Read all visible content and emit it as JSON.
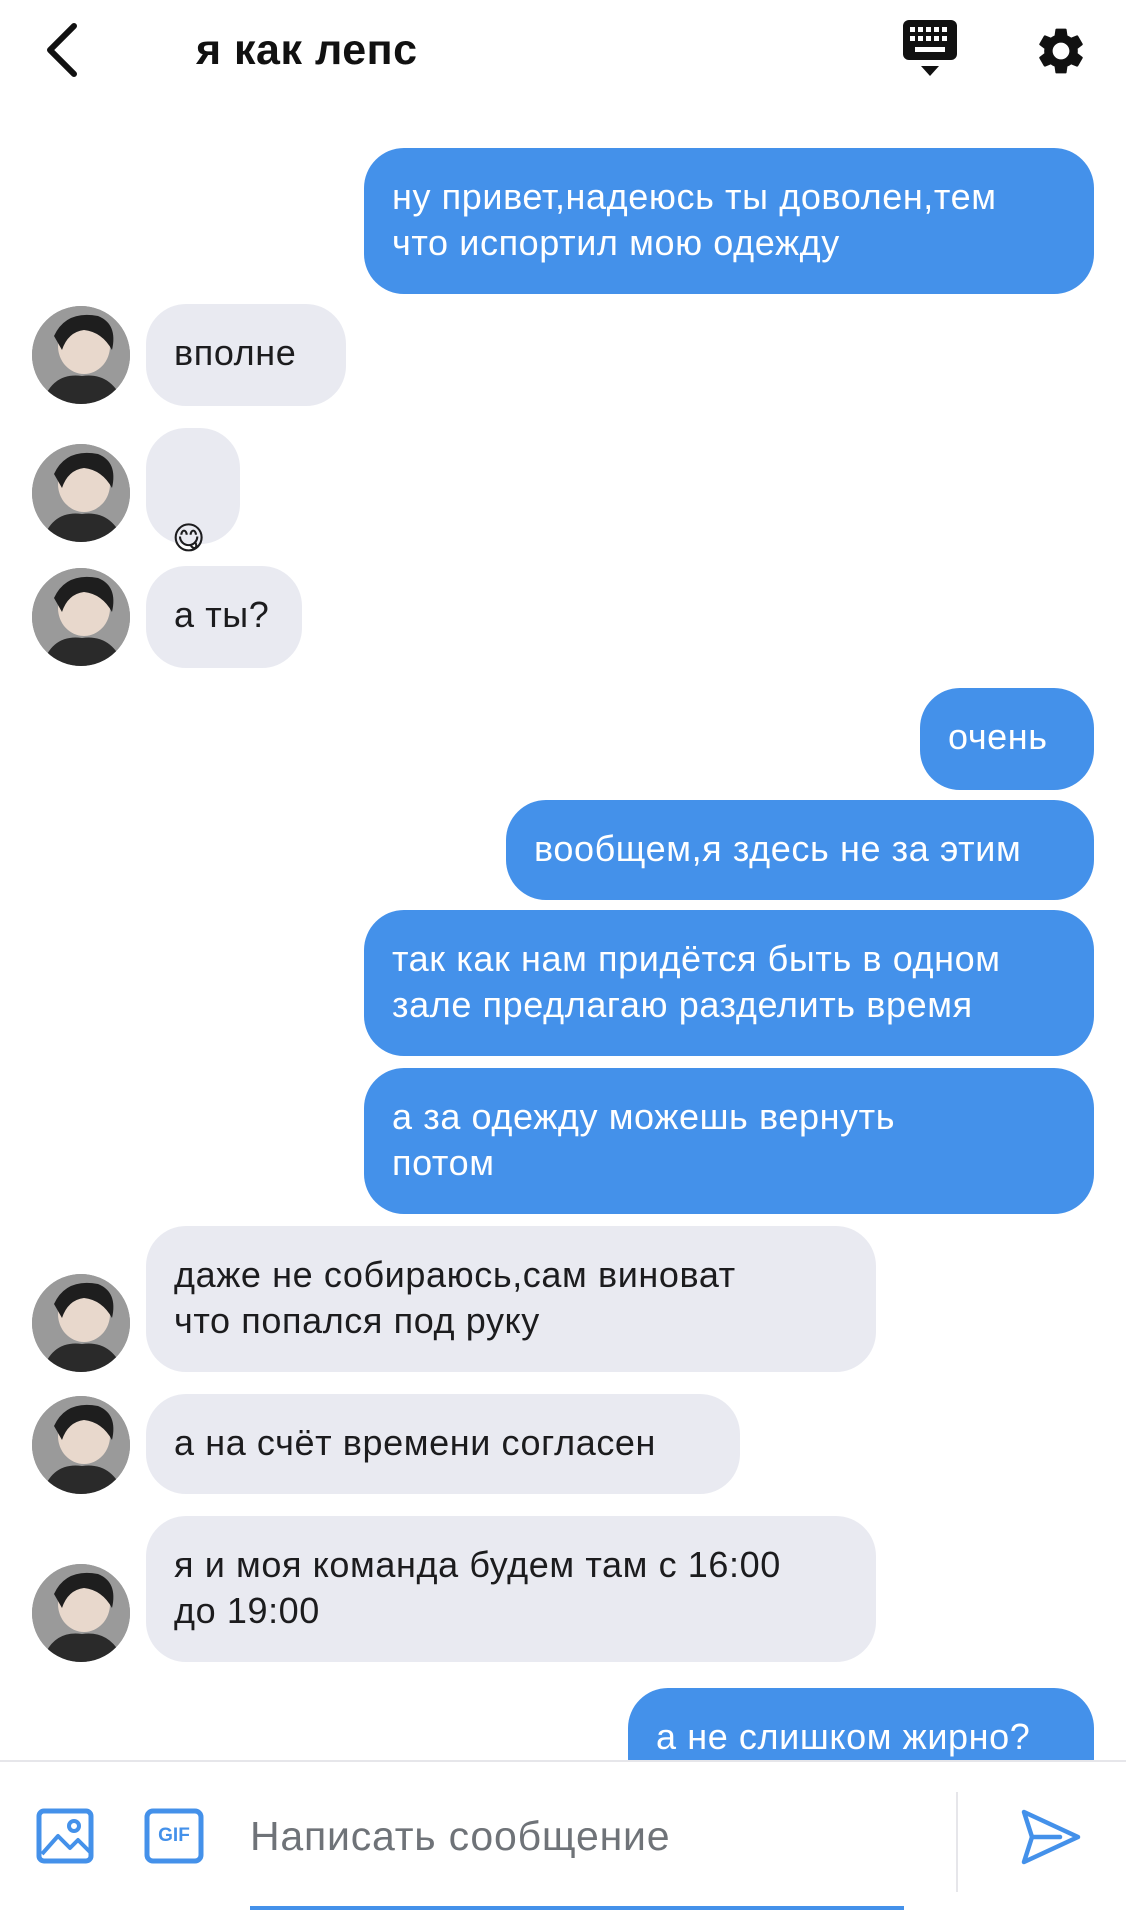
{
  "header": {
    "title": "я как лепс",
    "back_icon": "chevron-left-icon",
    "keyboard_icon": "keyboard-icon",
    "settings_icon": "gear-icon"
  },
  "colors": {
    "outgoing_bubble": "#4491ea",
    "incoming_bubble": "#e9eaf1",
    "accent": "#4491ea"
  },
  "messages": [
    {
      "direction": "out",
      "text": "ну привет,надеюсь ты доволен,тем\nчто испортил мою одежду"
    },
    {
      "direction": "in",
      "text": "вполне"
    },
    {
      "direction": "in",
      "text": "😋",
      "emoji_icon": "smiley-emoji-icon"
    },
    {
      "direction": "in",
      "text": "а ты?"
    },
    {
      "direction": "out",
      "text": "очень"
    },
    {
      "direction": "out",
      "text": "вообщем,я здесь не за этим"
    },
    {
      "direction": "out",
      "text": "так как нам придётся быть в одном\nзале предлагаю разделить время"
    },
    {
      "direction": "out",
      "text": "а за одежду можешь вернуть\nпотом"
    },
    {
      "direction": "in",
      "text": "даже не собираюсь,сам виноват\nчто попался под руку"
    },
    {
      "direction": "in",
      "text": "а на счёт времени согласен"
    },
    {
      "direction": "in",
      "text": "я и моя команда будем там с 16:00\nдо 19:00"
    },
    {
      "direction": "out",
      "text": "а не слишком жирно?"
    }
  ],
  "composer": {
    "placeholder": "Написать сообщение",
    "value": "",
    "photo_icon": "image-icon",
    "gif_label": "GIF",
    "send_icon": "send-icon"
  }
}
